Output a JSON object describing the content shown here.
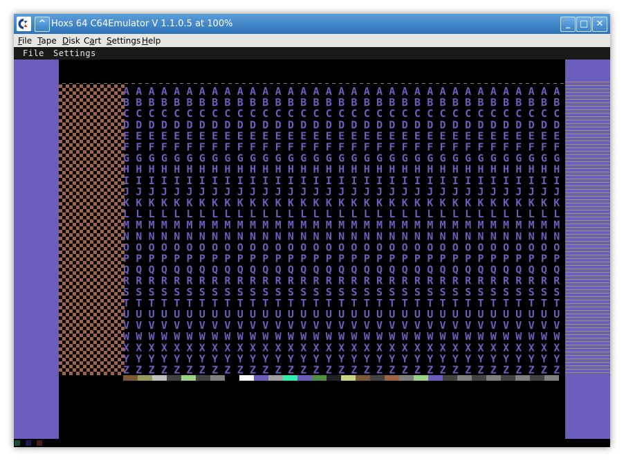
{
  "window": {
    "title": "Hoxs 64 C64Emulator V 1.1.0.5 at 100%",
    "controls": {
      "collapse": "^",
      "minimize": "_",
      "maximize": "□",
      "close": "✕"
    }
  },
  "menubar": {
    "items": [
      {
        "label": "File",
        "mnemonic": "F"
      },
      {
        "label": "Tape",
        "mnemonic": "T"
      },
      {
        "label": "Disk",
        "mnemonic": "D"
      },
      {
        "label": "Cart",
        "mnemonic": "a"
      },
      {
        "label": "Settings",
        "mnemonic": "S"
      },
      {
        "label": "Help",
        "mnemonic": "H"
      }
    ]
  },
  "emulator_menu": {
    "items": [
      {
        "label": "File"
      },
      {
        "label": "Settings"
      }
    ]
  },
  "screen": {
    "glyph_rows": [
      "A",
      "B",
      "C",
      "D",
      "E",
      "F",
      "G",
      "H",
      "I",
      "J",
      "K",
      "L",
      "M",
      "N",
      "O",
      "P",
      "Q",
      "R",
      "S",
      "T",
      "U",
      "V",
      "W",
      "X",
      "Y",
      "Z"
    ],
    "colors": {
      "border": "#6c5ebc",
      "checker_a": "#a0644a",
      "checker_b": "#000000",
      "glyph": "#6c5ebc",
      "stripe": "#9a9a5e"
    },
    "color_strip": [
      "#7b5a3a",
      "#9a9a5e",
      "#c0c0c0",
      "#444444",
      "#9ad284",
      "#444444",
      "#808080",
      "#000000",
      "#ffffff",
      "#6c5ebc",
      "#a0a0a0",
      "#3ea",
      "#6c5ebc",
      "#4f8f3f",
      "#222222",
      "#c9d487",
      "#7b5a3a",
      "#444444",
      "#a0644a",
      "#808080",
      "#9ad284",
      "#6c5ebc",
      "#444444",
      "#808080",
      "#444444",
      "#808080",
      "#444444",
      "#808080",
      "#444444",
      "#808080"
    ],
    "bottom_squares": [
      "#1d4a3a",
      "#1b1b5a",
      "#4a1b1b"
    ]
  }
}
